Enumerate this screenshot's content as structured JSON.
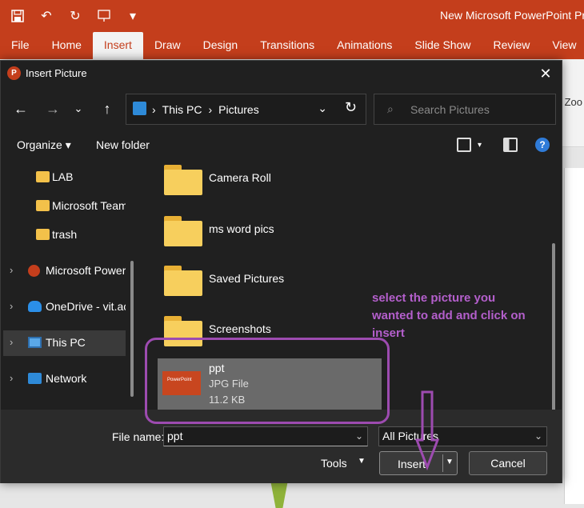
{
  "powerpoint": {
    "title": "New Microsoft PowerPoint Pr",
    "tabs": [
      "File",
      "Home",
      "Insert",
      "Draw",
      "Design",
      "Transitions",
      "Animations",
      "Slide Show",
      "Review",
      "View"
    ],
    "active_tab": "Insert",
    "zoom_label": "Zoo"
  },
  "dialog": {
    "title": "Insert Picture",
    "address": {
      "crumbs": [
        "This PC",
        "Pictures"
      ]
    },
    "search_placeholder": "Search Pictures",
    "commands": {
      "organize": "Organize",
      "new_folder": "New folder"
    },
    "sidebar": [
      {
        "label": "LAB",
        "icon": "folder-icon"
      },
      {
        "label": "Microsoft Team",
        "icon": "folder-icon"
      },
      {
        "label": "trash",
        "icon": "folder-icon"
      },
      {
        "label": "Microsoft PowerP",
        "icon": "powerpoint-icon"
      },
      {
        "label": "OneDrive - vit.ac.",
        "icon": "onedrive-icon"
      },
      {
        "label": "This PC",
        "icon": "computer-icon",
        "selected": true
      },
      {
        "label": "Network",
        "icon": "network-icon"
      }
    ],
    "files": [
      {
        "name": "Camera Roll",
        "type": "folder"
      },
      {
        "name": "ms word pics",
        "type": "folder"
      },
      {
        "name": "Saved Pictures",
        "type": "folder"
      },
      {
        "name": "Screenshots",
        "type": "folder"
      },
      {
        "name": "ppt",
        "type": "JPG File",
        "size": "11.2 KB",
        "thumb_text": "PowerPoint",
        "selected": true
      }
    ],
    "file_name_label": "File name:",
    "file_name_value": "ppt",
    "file_type": "All Pictures",
    "tools_label": "Tools",
    "insert_label": "Insert",
    "cancel_label": "Cancel"
  },
  "annotation": {
    "text": "select the picture you wanted to add and click on insert",
    "color": "#9d4bb0"
  },
  "colors": {
    "ppt_accent": "#c43e1c",
    "dialog_bg": "#202020"
  }
}
